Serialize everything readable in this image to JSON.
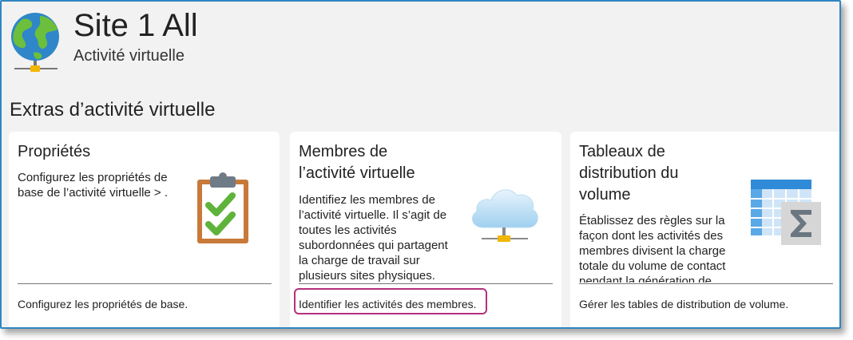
{
  "header": {
    "title": "Site 1 All",
    "subtitle": "Activité virtuelle",
    "icon": "globe-network-icon"
  },
  "section": {
    "title": "Extras d’activité virtuelle"
  },
  "cards": [
    {
      "title_lines": [
        "Propriétés"
      ],
      "description_lines": [
        "Configurez les propriétés de",
        "base de l’activité virtuelle > ."
      ],
      "link": "Configurez les propriétés de base.",
      "icon": "clipboard-checklist-icon"
    },
    {
      "title_lines": [
        "Membres de",
        "l’activité virtuelle"
      ],
      "description_lines": [
        "Identifiez les membres de",
        "l’activité virtuelle. Il s’agit de",
        "toutes les activités",
        "subordonnées qui partagent",
        "la charge de travail sur",
        "plusieurs sites physiques."
      ],
      "link": "Identifier les activités des membres.",
      "icon": "cloud-network-icon"
    },
    {
      "title_lines": [
        "Tableaux de",
        "distribution du",
        "volume"
      ],
      "description_lines": [
        "Établissez des règles sur la",
        "façon dont les activités des",
        "membres divisent la charge",
        "totale du volume de contact",
        "pendant la génération de"
      ],
      "link": "Gérer les tables de distribution de volume.",
      "icon": "table-sum-icon"
    }
  ],
  "colors": {
    "frame_border": "#2e86c1",
    "highlight": "#b5307c",
    "background": "#f2f2f2"
  }
}
